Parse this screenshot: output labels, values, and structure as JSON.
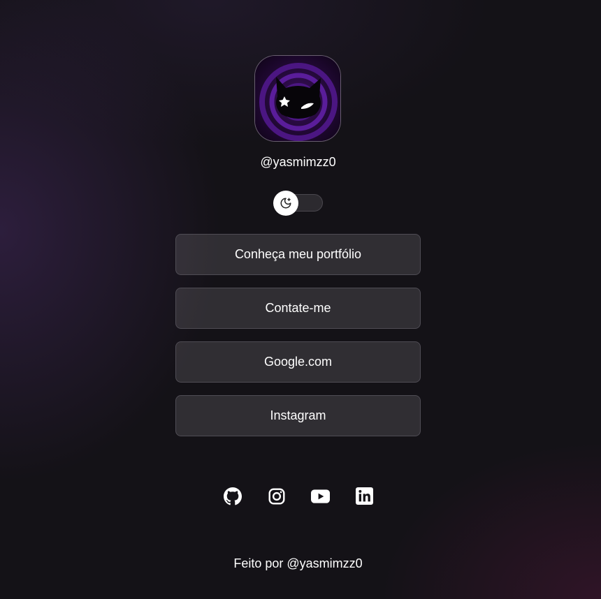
{
  "profile": {
    "username": "@yasmimzz0",
    "avatar_icon": "black-cat-icon"
  },
  "theme_toggle": {
    "icon": "moon-stars-icon",
    "state": "dark"
  },
  "links": [
    {
      "label": "Conheça meu portfólio"
    },
    {
      "label": "Contate-me"
    },
    {
      "label": "Google.com"
    },
    {
      "label": "Instagram"
    }
  ],
  "socials": [
    {
      "icon": "github-icon"
    },
    {
      "icon": "instagram-icon"
    },
    {
      "icon": "youtube-icon"
    },
    {
      "icon": "linkedin-icon"
    }
  ],
  "footer": {
    "text": "Feito por @yasmimzz0"
  },
  "colors": {
    "background": "#141217",
    "button_bg": "#2e2c32",
    "button_border": "#4f4c54",
    "accent_purple": "#5b1f99",
    "text": "#ffffff"
  }
}
